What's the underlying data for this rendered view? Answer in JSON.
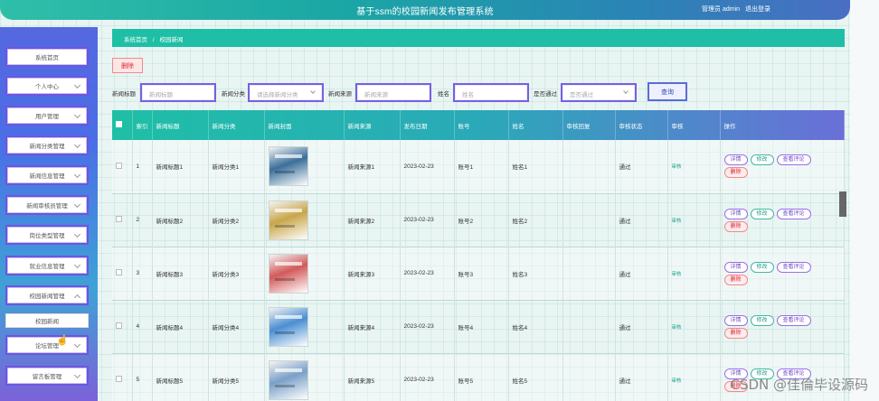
{
  "header": {
    "title": "基于ssm的校园新闻发布管理系统",
    "user_label": "管理员 admin",
    "logout_label": "退出登录"
  },
  "sidebar": {
    "items": [
      {
        "label": "系统首页",
        "has_chevron": false
      },
      {
        "label": "个人中心",
        "has_chevron": true
      },
      {
        "label": "用户管理",
        "has_chevron": true
      },
      {
        "label": "新闻分类管理",
        "has_chevron": true
      },
      {
        "label": "新闻信息管理",
        "has_chevron": true
      },
      {
        "label": "新闻审核员管理",
        "has_chevron": true
      },
      {
        "label": "岗位类型管理",
        "has_chevron": true
      },
      {
        "label": "就业信息管理",
        "has_chevron": true
      },
      {
        "label": "校园新闻管理",
        "has_chevron": true
      },
      {
        "label": "校园新闻",
        "sub": true
      },
      {
        "label": "论坛管理",
        "has_chevron": true
      },
      {
        "label": "留言板管理",
        "has_chevron": true
      }
    ]
  },
  "breadcrumb": {
    "home": "系统首页",
    "separator": "/",
    "current": "校园新闻"
  },
  "toolbar": {
    "delete_label": "删除"
  },
  "search": {
    "title_label": "新闻标题",
    "title_placeholder": "新闻标题",
    "category_label": "新闻分类",
    "category_placeholder": "请选择新闻分类",
    "source_label": "新闻来源",
    "source_placeholder": "新闻来源",
    "name_label": "姓名",
    "name_placeholder": "姓名",
    "passed_label": "是否通过",
    "passed_placeholder": "是否通过",
    "query_label": "查询"
  },
  "table": {
    "columns": [
      "索引",
      "新闻标题",
      "新闻分类",
      "新闻封面",
      "新闻来源",
      "发布日期",
      "账号",
      "姓名",
      "审核回复",
      "审核状态",
      "审核",
      "操作"
    ],
    "rows": [
      {
        "index": "1",
        "title": "新闻标题1",
        "category": "新闻分类1",
        "source": "新闻来源1",
        "date": "2023-02-23",
        "account": "账号1",
        "name": "姓名1",
        "reply": "",
        "status": "通过",
        "audit": "审核",
        "cover_color": "#3a6f9a"
      },
      {
        "index": "2",
        "title": "新闻标题2",
        "category": "新闻分类2",
        "source": "新闻来源2",
        "date": "2023-02-23",
        "account": "账号2",
        "name": "姓名2",
        "reply": "",
        "status": "通过",
        "audit": "审核",
        "cover_color": "#c8a64a"
      },
      {
        "index": "3",
        "title": "新闻标题3",
        "category": "新闻分类3",
        "source": "新闻来源3",
        "date": "2023-02-23",
        "account": "账号3",
        "name": "姓名3",
        "reply": "",
        "status": "通过",
        "audit": "审核",
        "cover_color": "#d25a5a"
      },
      {
        "index": "4",
        "title": "新闻标题4",
        "category": "新闻分类4",
        "source": "新闻来源4",
        "date": "2023-02-23",
        "account": "账号4",
        "name": "姓名4",
        "reply": "",
        "status": "通过",
        "audit": "审核",
        "cover_color": "#4a8fd2"
      },
      {
        "index": "5",
        "title": "新闻标题5",
        "category": "新闻分类5",
        "source": "新闻来源5",
        "date": "2023-02-23",
        "account": "账号5",
        "name": "姓名5",
        "reply": "",
        "status": "通过",
        "audit": "审核",
        "cover_color": "#7aa0c8"
      }
    ],
    "actions": {
      "detail": "详情",
      "edit": "修改",
      "comment": "查看评论",
      "delete": "删除"
    }
  },
  "watermark": "CSDN @佳倫毕设源码",
  "colors": {
    "accent": "#1ebfa6",
    "sidebar": "#5568e0",
    "danger": "#d22233"
  }
}
